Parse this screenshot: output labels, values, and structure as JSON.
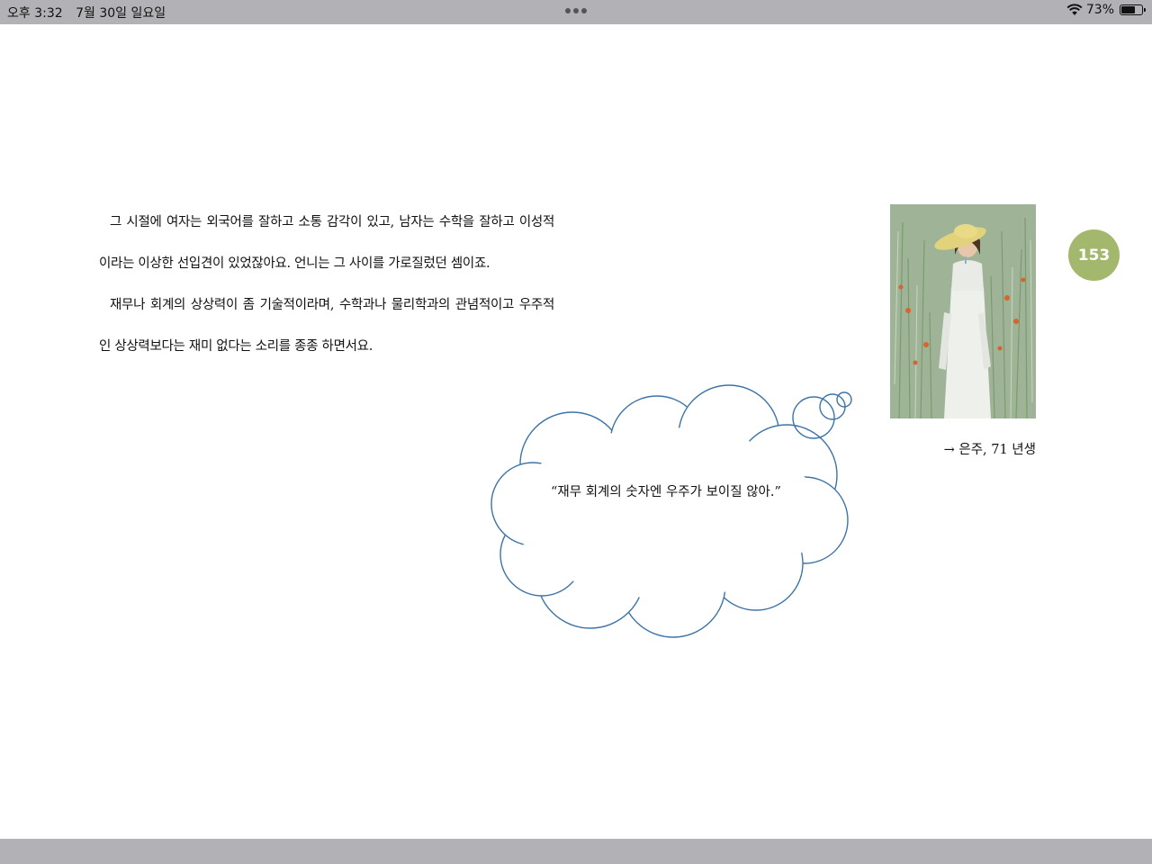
{
  "status_bar": {
    "time": "오후 3:32",
    "date": "7월 30일 일요일",
    "battery_percent": "73%",
    "battery_level": 0.73
  },
  "content": {
    "paragraph1": "그 시절에 여자는 외국어를 잘하고 소통 감각이 있고, 남자는 수학을 잘하고 이성적이라는 이상한 선입견이 있었잖아요. 언니는 그 사이를 가로질렀던 셈이죠.",
    "paragraph2": "재무나 회계의 상상력이 좀 기술적이라며, 수학과나 물리학과의 관념적이고 우주적인 상상력보다는 재미 없다는 소리를 종종 하면서요.",
    "quote": "“재무 회계의 숫자엔 우주가 보이질 않아.”",
    "caption": "→ 은주, 71 년생",
    "page_number": "153"
  },
  "colors": {
    "page_badge": "#a3b86c",
    "bubble_stroke": "#3c74a7",
    "bars": "#b2b2b6"
  }
}
